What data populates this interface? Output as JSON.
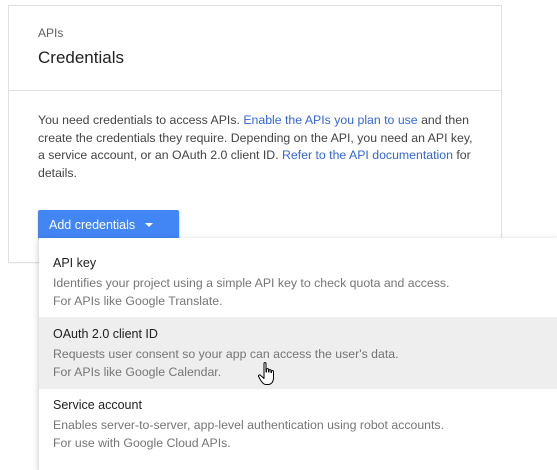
{
  "card": {
    "supertitle": "APIs",
    "title": "Credentials",
    "description": {
      "part1": "You need credentials to access APIs. ",
      "link1": "Enable the APIs you plan to use",
      "part2": " and then create the credentials they require. Depending on the API, you need an API key, a service account, or an OAuth 2.0 client ID. ",
      "link2": "Refer to the API documentation",
      "part3": " for details."
    },
    "add_button": "Add credentials"
  },
  "menu": {
    "items": [
      {
        "title": "API key",
        "description": "Identifies your project using a simple API key to check quota and access.",
        "subtitle": "For APIs like Google Translate."
      },
      {
        "title": "OAuth 2.0 client ID",
        "description": "Requests user consent so your app can access the user's data.",
        "subtitle": "For APIs like Google Calendar."
      },
      {
        "title": "Service account",
        "description": "Enables server-to-server, app-level authentication using robot accounts.",
        "subtitle": "For use with Google Cloud APIs."
      }
    ]
  },
  "colors": {
    "accent": "#4285f4",
    "link": "#3367d6",
    "hover": "#eeeeee"
  },
  "icons": [
    "caret-down-icon",
    "hand-pointer-icon"
  ]
}
